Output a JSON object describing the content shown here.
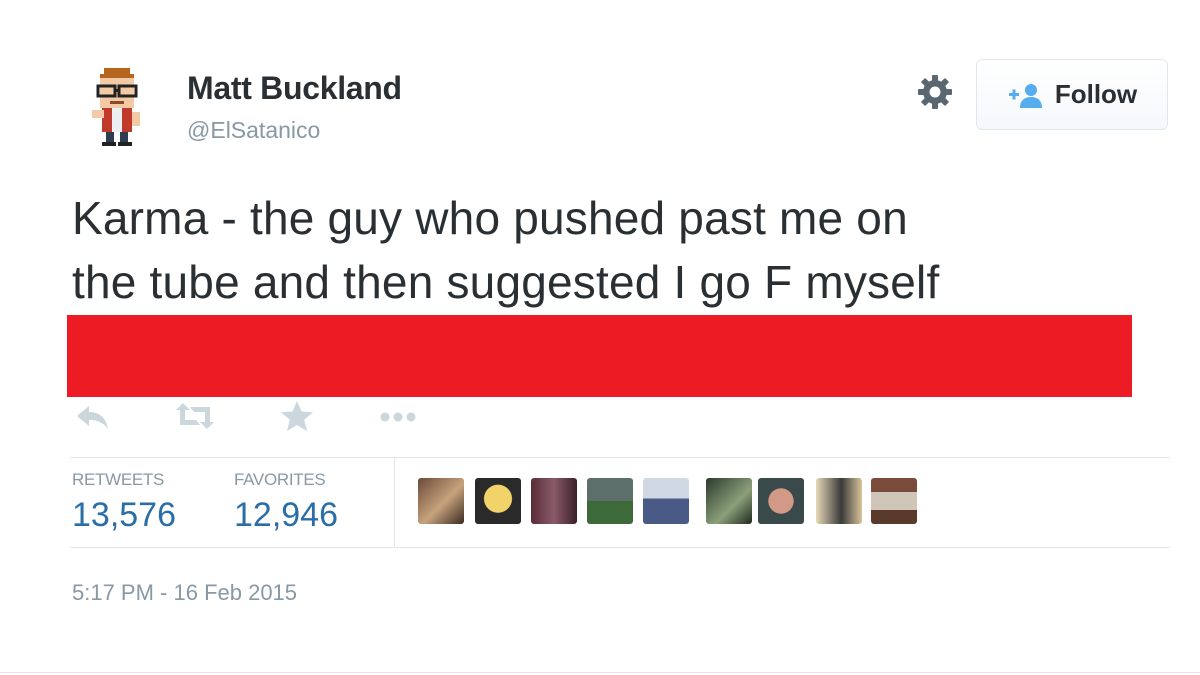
{
  "author": {
    "name": "Matt Buckland",
    "handle": "@ElSatanico",
    "avatar_icon": "pixel-character-avatar-icon"
  },
  "header": {
    "settings_icon": "gear-icon",
    "follow_label": "Follow",
    "follow_icon": "add-user-icon"
  },
  "tweet": {
    "text_line1": "Karma - the guy who pushed past me on",
    "text_line2": "the tube and then suggested I go F myself",
    "redaction_color": "#ed1b24"
  },
  "actions": [
    {
      "name": "reply-icon"
    },
    {
      "name": "retweet-icon"
    },
    {
      "name": "favorite-star-icon"
    },
    {
      "name": "more-dots-icon"
    }
  ],
  "stats": {
    "retweets_label": "RETWEETS",
    "retweets_value": "13,576",
    "favorites_label": "FAVORITES",
    "favorites_value": "12,946"
  },
  "favoriters": [
    {
      "name": "user-avatar-1"
    },
    {
      "name": "user-avatar-2"
    },
    {
      "name": "user-avatar-3"
    },
    {
      "name": "user-avatar-4"
    },
    {
      "name": "user-avatar-5"
    },
    {
      "name": "user-avatar-6"
    },
    {
      "name": "user-avatar-7"
    },
    {
      "name": "user-avatar-8"
    },
    {
      "name": "user-avatar-9"
    }
  ],
  "timestamp": "5:17 PM - 16 Feb 2015",
  "colors": {
    "text": "#292f33",
    "muted": "#8899a6",
    "link_blue": "#2b6ea6",
    "follow_icon_blue": "#55acee",
    "border": "#e1e8ed"
  }
}
